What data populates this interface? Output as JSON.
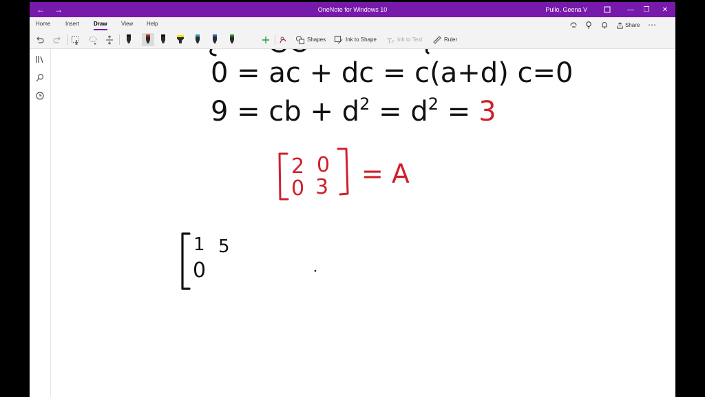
{
  "titlebar": {
    "title": "OneNote for Windows 10",
    "user": "Pullo, Geena V",
    "back_label": "←",
    "forward_label": "→",
    "minimize_label": "—",
    "maximize_label": "❐",
    "close_label": "✕"
  },
  "tabs": [
    {
      "label": "Home"
    },
    {
      "label": "Insert"
    },
    {
      "label": "Draw"
    },
    {
      "label": "View"
    },
    {
      "label": "Help"
    }
  ],
  "active_tab": "Draw",
  "header_right": {
    "share_label": "Share",
    "more_label": "⋯"
  },
  "toolbar": {
    "shapes_label": "Shapes",
    "ink_to_shape_label": "Ink to Shape",
    "ink_to_text_label": "Ink to Text",
    "ruler_label": "Ruler",
    "pens": [
      {
        "name": "black-pen",
        "color": "#111111"
      },
      {
        "name": "red-pen",
        "color": "#d0202c"
      },
      {
        "name": "black-pen-2",
        "color": "#111111"
      },
      {
        "name": "yellow-highlighter",
        "color": "#ffe100"
      },
      {
        "name": "teal-pen",
        "color": "#1aa7c9"
      },
      {
        "name": "blue-pen",
        "color": "#1e66d0"
      },
      {
        "name": "green-pen",
        "color": "#1f9b3a"
      }
    ]
  },
  "ink": {
    "line1": "0 = ac + dc  = c(a+d)   c=0",
    "line2_black": "9 = cb + d",
    "line2_sup": "2",
    "line2_mid": " = d",
    "line2_sup2": "2",
    "line2_eq": " =",
    "line2_red": "3",
    "matrix_a": [
      [
        "2",
        "0"
      ],
      [
        "0",
        "3"
      ]
    ],
    "matrix_a_rhs": "= A",
    "matrix_b": [
      [
        "1",
        "5"
      ],
      [
        "0",
        ""
      ]
    ]
  },
  "colors": {
    "accent": "#7719aa",
    "ink_black": "#111111",
    "ink_red": "#d0202c"
  }
}
